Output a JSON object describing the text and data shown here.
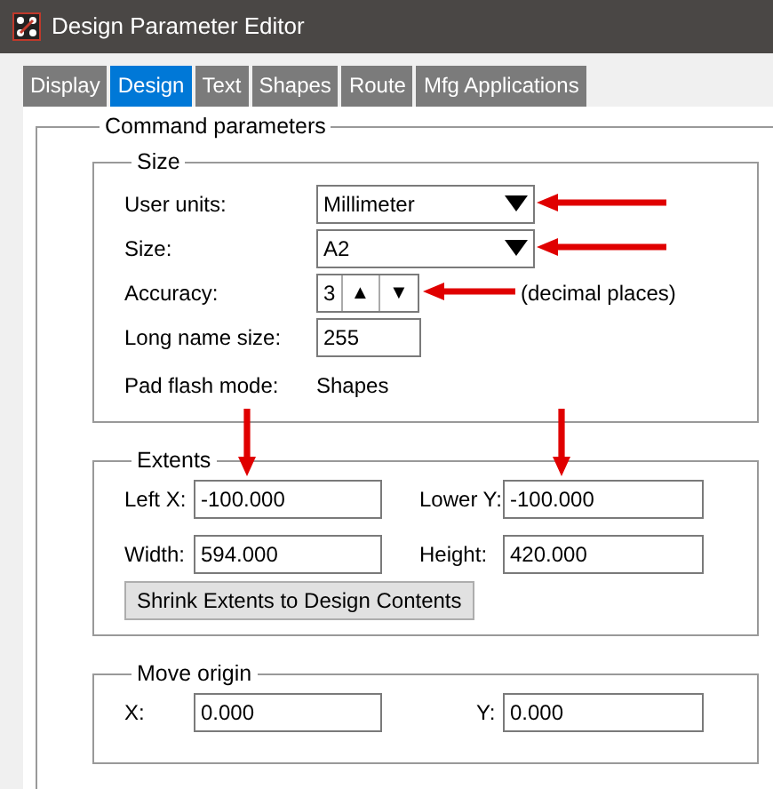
{
  "window": {
    "title": "Design Parameter Editor"
  },
  "tabs": [
    {
      "label": "Display",
      "selected": false
    },
    {
      "label": "Design",
      "selected": true
    },
    {
      "label": "Text",
      "selected": false
    },
    {
      "label": "Shapes",
      "selected": false
    },
    {
      "label": "Route",
      "selected": false
    },
    {
      "label": "Mfg Applications",
      "selected": false
    }
  ],
  "command_parameters": {
    "title": "Command parameters",
    "size": {
      "title": "Size",
      "rows": [
        {
          "kind": "dropdown",
          "label": "User units:",
          "value": "Millimeter",
          "arrow": true
        },
        {
          "kind": "dropdown",
          "label": "Size:",
          "value": "A2",
          "arrow": true
        },
        {
          "kind": "spinner",
          "label": "Accuracy:",
          "value": "3",
          "up": "▲",
          "down": "▼",
          "note": "(decimal places)",
          "arrow": true
        },
        {
          "kind": "input",
          "label": "Long name size:",
          "value": "255"
        },
        {
          "kind": "text",
          "label": "Pad flash mode:",
          "value": "Shapes"
        }
      ]
    },
    "extents": {
      "title": "Extents",
      "fields": [
        {
          "label": "Left X:",
          "value": "-100.000",
          "arrow": true
        },
        {
          "label": "Lower Y:",
          "value": "-100.000",
          "arrow": true
        },
        {
          "label": "Width:",
          "value": "594.000"
        },
        {
          "label": "Height:",
          "value": "420.000"
        }
      ],
      "button": "Shrink Extents to Design Contents"
    },
    "move_origin": {
      "title": "Move origin",
      "fields": [
        {
          "label": "X:",
          "value": "0.000"
        },
        {
          "label": "Y:",
          "value": "0.000"
        }
      ]
    }
  }
}
